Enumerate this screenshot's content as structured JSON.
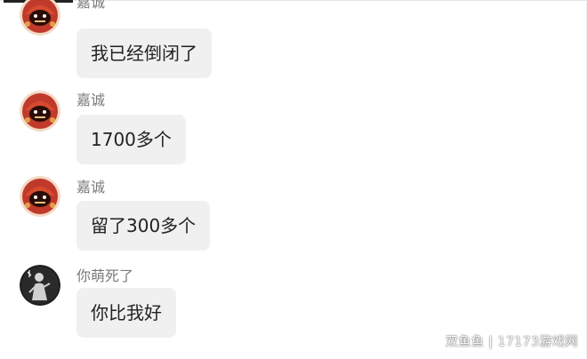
{
  "messages": [
    {
      "sender": "嘉诚",
      "text": "我已经倒闭了",
      "avatar_icon": "red-mascot-avatar"
    },
    {
      "sender": "嘉诚",
      "text": "1700多个",
      "avatar_icon": "red-mascot-avatar"
    },
    {
      "sender": "嘉诚",
      "text": "留了300多个",
      "avatar_icon": "red-mascot-avatar"
    },
    {
      "sender": "你萌死了",
      "text": "你比我好",
      "avatar_icon": "dark-sketch-avatar"
    }
  ],
  "watermark": "双鱼鱼 | 17173游戏网",
  "colors": {
    "bubble_bg": "#f0f0f0",
    "sender_text": "#7a7a7a",
    "message_text": "#222222",
    "avatar_red": "#c0392b"
  }
}
